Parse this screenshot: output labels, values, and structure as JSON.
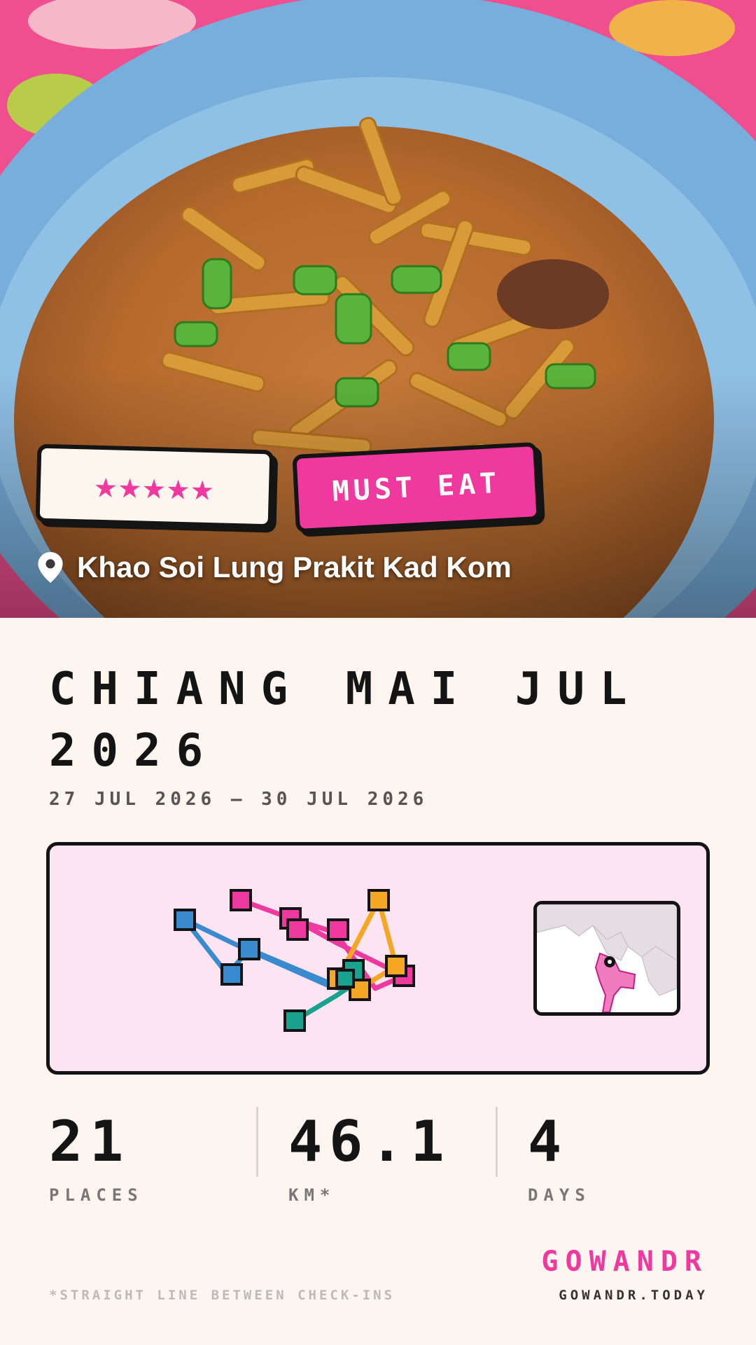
{
  "hero": {
    "image_description_icon": "khao-soi-photo",
    "rating": "★★★★★",
    "rating_value": 5,
    "rating_max": 5,
    "badge": "MUST EAT",
    "location_icon": "location-pin-icon",
    "place_name": "Khao Soi Lung Prakit Kad Kom"
  },
  "trip": {
    "title": "CHIANG MAI JUL 2026",
    "dates": "27 JUL 2026 – 30 JUL 2026"
  },
  "stats": [
    {
      "value": "21",
      "label": "PLACES"
    },
    {
      "value": "46.1",
      "label": "KM*"
    },
    {
      "value": "4",
      "label": "DAYS"
    }
  ],
  "footer": {
    "brand": "GOWANDR",
    "footnote": "*STRAIGHT LINE BETWEEN CHECK-INS",
    "url": "GOWANDR.TODAY"
  },
  "colors": {
    "accent_pink": "#f0399e",
    "route_blue": "#3a8ad0",
    "route_orange": "#f5a623",
    "route_teal": "#19a38f",
    "route_pink": "#f0399e",
    "map_bg": "#fde4f2",
    "page_bg": "#fdf5f0"
  }
}
